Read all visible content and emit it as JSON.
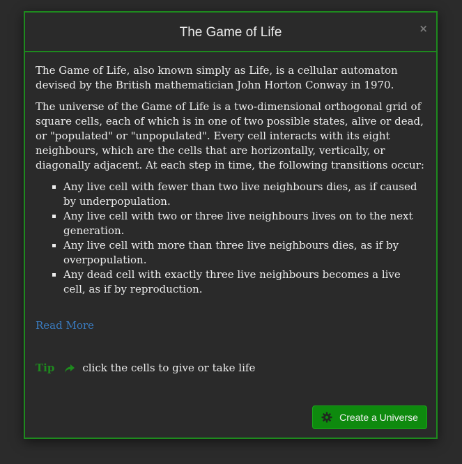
{
  "modal": {
    "title": "The Game of Life",
    "close_label": "×",
    "paragraphs": [
      "The Game of Life, also known simply as Life, is a cellular automaton devised by the British mathematician John Horton Conway in 1970.",
      "The universe of the Game of Life is a two-dimensional orthogonal grid of square cells, each of which is in one of two possible states, alive or dead, or \"populated\" or \"unpopulated\". Every cell interacts with its eight neighbours, which are the cells that are horizontally, vertically, or diagonally adjacent. At each step in time, the following transitions occur:"
    ],
    "rules": [
      "Any live cell with fewer than two live neighbours dies, as if caused by underpopulation.",
      "Any live cell with two or three live neighbours lives on to the next generation.",
      "Any live cell with more than three live neighbours dies, as if by overpopulation.",
      "Any dead cell with exactly three live neighbours becomes a live cell, as if by reproduction."
    ],
    "read_more_label": "Read More",
    "tip": {
      "label": "Tip",
      "icon": "share-arrow-icon",
      "text": "click the cells to give or take life"
    },
    "create_button": {
      "icon": "gear-icon",
      "label": "Create a Universe"
    }
  },
  "colors": {
    "background": "#2b2b2b",
    "panel": "#2a2a2a",
    "accent_green": "#1e8a1e",
    "button_green": "#0e8a0e",
    "link_blue": "#3a7bbf",
    "text": "#ececec"
  }
}
